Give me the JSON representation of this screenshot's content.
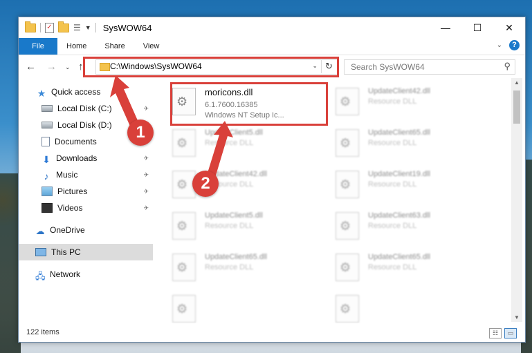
{
  "window": {
    "title": "SysWOW64",
    "controls": {
      "minimize": "—",
      "maximize": "☐",
      "close": "✕"
    }
  },
  "ribbon": {
    "tabs": [
      "File",
      "Home",
      "Share",
      "View"
    ],
    "help": "?"
  },
  "nav": {
    "address": "C:\\Windows\\SysWOW64",
    "search_placeholder": "Search SysWOW64"
  },
  "sidebar": {
    "items": [
      {
        "label": "Quick access",
        "icon": "star-icon"
      },
      {
        "label": "Local Disk (C:)",
        "icon": "disk-icon",
        "pinned": true
      },
      {
        "label": "Local Disk (D:)",
        "icon": "disk-icon"
      },
      {
        "label": "Documents",
        "icon": "documents-icon"
      },
      {
        "label": "Downloads",
        "icon": "download-icon",
        "pinned": true
      },
      {
        "label": "Music",
        "icon": "music-icon",
        "pinned": true
      },
      {
        "label": "Pictures",
        "icon": "pictures-icon",
        "pinned": true
      },
      {
        "label": "Videos",
        "icon": "videos-icon",
        "pinned": true
      },
      {
        "label": "OneDrive",
        "icon": "onedrive-icon"
      },
      {
        "label": "This PC",
        "icon": "pc-icon",
        "selected": true
      },
      {
        "label": "Network",
        "icon": "network-icon"
      }
    ]
  },
  "files": [
    {
      "name": "moricons.dll",
      "line2": "6.1.7600.16385",
      "line3": "Windows NT Setup Ic...",
      "blurred": false
    },
    {
      "name": "UpdateClient42.dll",
      "line2": "Resource DLL",
      "blurred": true
    },
    {
      "name": "UpdateClient5.dll",
      "line2": "Resource DLL",
      "blurred": true
    },
    {
      "name": "UpdateClient65.dll",
      "line2": "Resource DLL",
      "blurred": true
    },
    {
      "name": "UpdateClient42.dll",
      "line2": "Resource DLL",
      "blurred": true
    },
    {
      "name": "UpdateClient19.dll",
      "line2": "Resource DLL",
      "blurred": true
    },
    {
      "name": "UpdateClient5.dll",
      "line2": "Resource DLL",
      "blurred": true
    },
    {
      "name": "UpdateClient63.dll",
      "line2": "Resource DLL",
      "blurred": true
    },
    {
      "name": "UpdateClient65.dll",
      "line2": "Resource DLL",
      "blurred": true
    },
    {
      "name": "UpdateClient65.dll",
      "line2": "Resource DLL",
      "blurred": true
    }
  ],
  "annotations": {
    "callout1": "1",
    "callout2": "2",
    "color": "#d9403a"
  },
  "status": {
    "item_count": "122 items"
  },
  "colors": {
    "accent": "#1979ca",
    "selection": "#dcdcdc"
  }
}
